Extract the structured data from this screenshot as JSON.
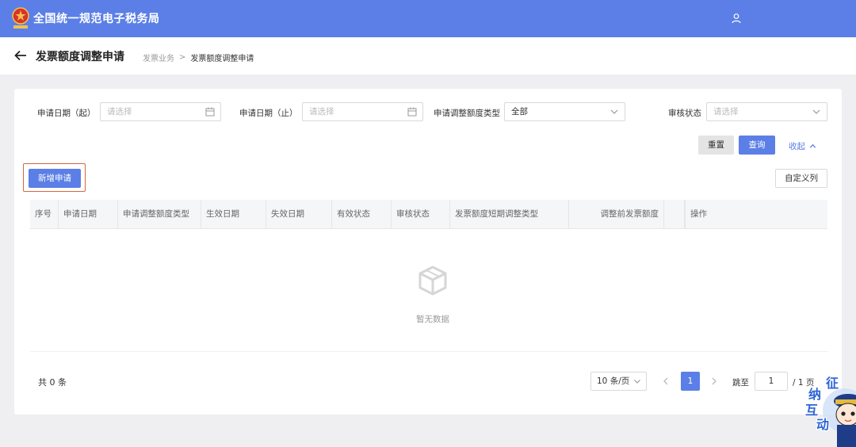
{
  "header": {
    "app_title": "全国统一规范电子税务局",
    "logo_icon": "tax-emblem-icon",
    "user_icon": "user-icon",
    "accent_color": "#5b7fe6"
  },
  "page": {
    "title": "发票额度调整申请",
    "breadcrumb": [
      "发票业务",
      "发票额度调整申请"
    ],
    "breadcrumb_separator": ">"
  },
  "filters": {
    "start_date": {
      "label": "申请日期（起）",
      "placeholder": "请选择"
    },
    "end_date": {
      "label": "申请日期（止）",
      "placeholder": "请选择"
    },
    "adjust_type": {
      "label": "申请调整额度类型",
      "value": "全部"
    },
    "review_status": {
      "label": "审核状态",
      "placeholder": "请选择"
    },
    "reset_label": "重置",
    "query_label": "查询",
    "collapse_label": "收起"
  },
  "actions": {
    "new_label": "新增申请",
    "custom_columns_label": "自定义列"
  },
  "table": {
    "columns": [
      "序号",
      "申请日期",
      "申请调整额度类型",
      "生效日期",
      "失效日期",
      "有效状态",
      "审核状态",
      "发票额度短期调整类型",
      "调整前发票额度",
      "",
      "操作"
    ],
    "empty_text": "暂无数据"
  },
  "pagination": {
    "total_text": "共 0 条",
    "page_size": "10 条/页",
    "current_page": "1",
    "goto_label": "跳至",
    "goto_value": "1",
    "total_pages": "/ 1 页"
  },
  "mascot": {
    "chars": [
      "征",
      "纳",
      "互",
      "动"
    ]
  }
}
